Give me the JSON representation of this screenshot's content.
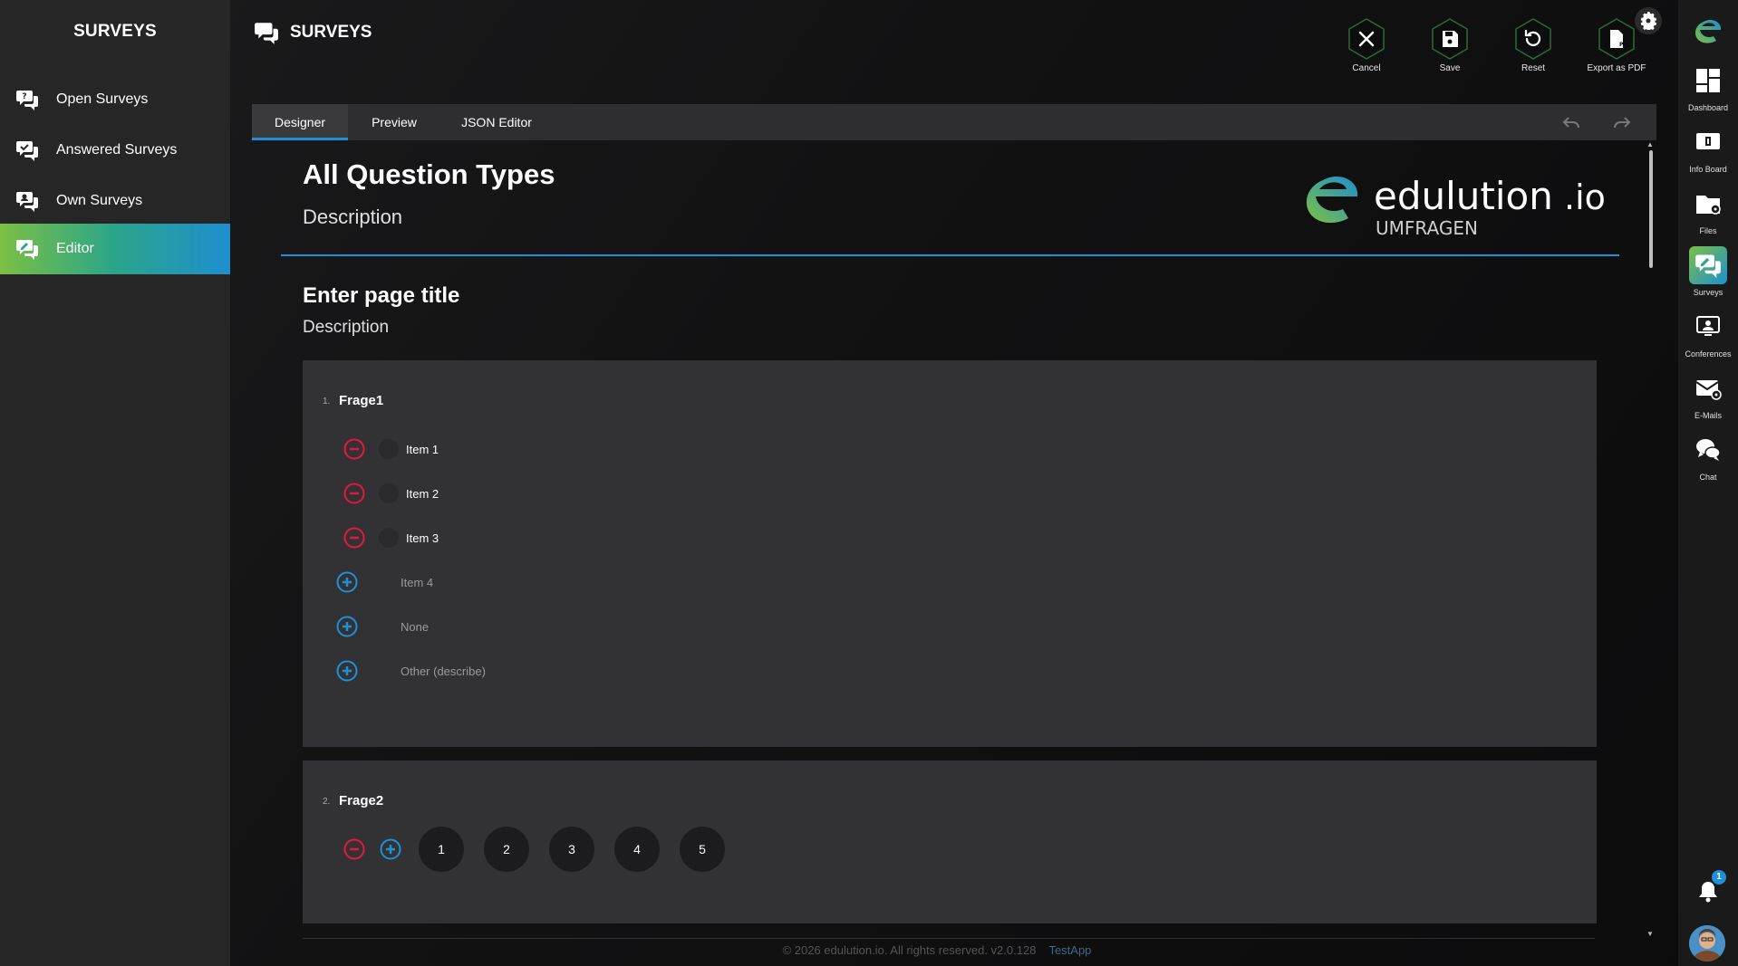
{
  "sidebar": {
    "title": "SURVEYS",
    "items": [
      {
        "label": "Open Surveys",
        "icon": "survey-icon"
      },
      {
        "label": "Answered Surveys",
        "icon": "survey-icon"
      },
      {
        "label": "Own Surveys",
        "icon": "survey-icon"
      },
      {
        "label": "Editor",
        "icon": "survey-edit-icon",
        "active": true
      }
    ]
  },
  "header": {
    "title": "SURVEYS",
    "actions": [
      {
        "label": "Cancel",
        "icon": "close-icon"
      },
      {
        "label": "Save",
        "icon": "save-icon"
      },
      {
        "label": "Reset",
        "icon": "reset-icon"
      },
      {
        "label": "Export as PDF",
        "icon": "pdf-icon"
      }
    ]
  },
  "tabs": [
    {
      "label": "Designer",
      "active": true
    },
    {
      "label": "Preview"
    },
    {
      "label": "JSON Editor"
    }
  ],
  "survey": {
    "title": "All Question Types",
    "description": "Description",
    "logo": {
      "brand": "edulution",
      "suffix": ".io",
      "subtitle": "UMFRAGEN"
    }
  },
  "page": {
    "title": "Enter page title",
    "description": "Description"
  },
  "questions": [
    {
      "number": "1.",
      "title": "Frage1",
      "choices": [
        "Item 1",
        "Item 2",
        "Item 3"
      ],
      "add_choices": [
        "Item 4",
        "None",
        "Other (describe)"
      ]
    },
    {
      "number": "2.",
      "title": "Frage2",
      "rating": [
        "1",
        "2",
        "3",
        "4",
        "5"
      ]
    }
  ],
  "footer": {
    "copyright": "© 2026 edulution.io. All rights reserved. v2.0.128",
    "app": "TestApp"
  },
  "rail": {
    "items": [
      {
        "label": "Dashboard",
        "icon": "dashboard-icon"
      },
      {
        "label": "Info Board",
        "icon": "info-board-icon"
      },
      {
        "label": "Files",
        "icon": "files-icon"
      },
      {
        "label": "Surveys",
        "icon": "surveys-icon",
        "active": true
      },
      {
        "label": "Conferences",
        "icon": "conferences-icon"
      },
      {
        "label": "E-Mails",
        "icon": "mail-icon"
      },
      {
        "label": "Chat",
        "icon": "chat-icon"
      }
    ],
    "notifications": "1"
  },
  "colors": {
    "accent": "#1f8fd6",
    "remove": "#e5173f",
    "add": "#1f8fd6",
    "active_gradient_start": "#7bc043",
    "active_gradient_end": "#1e8fd0"
  }
}
